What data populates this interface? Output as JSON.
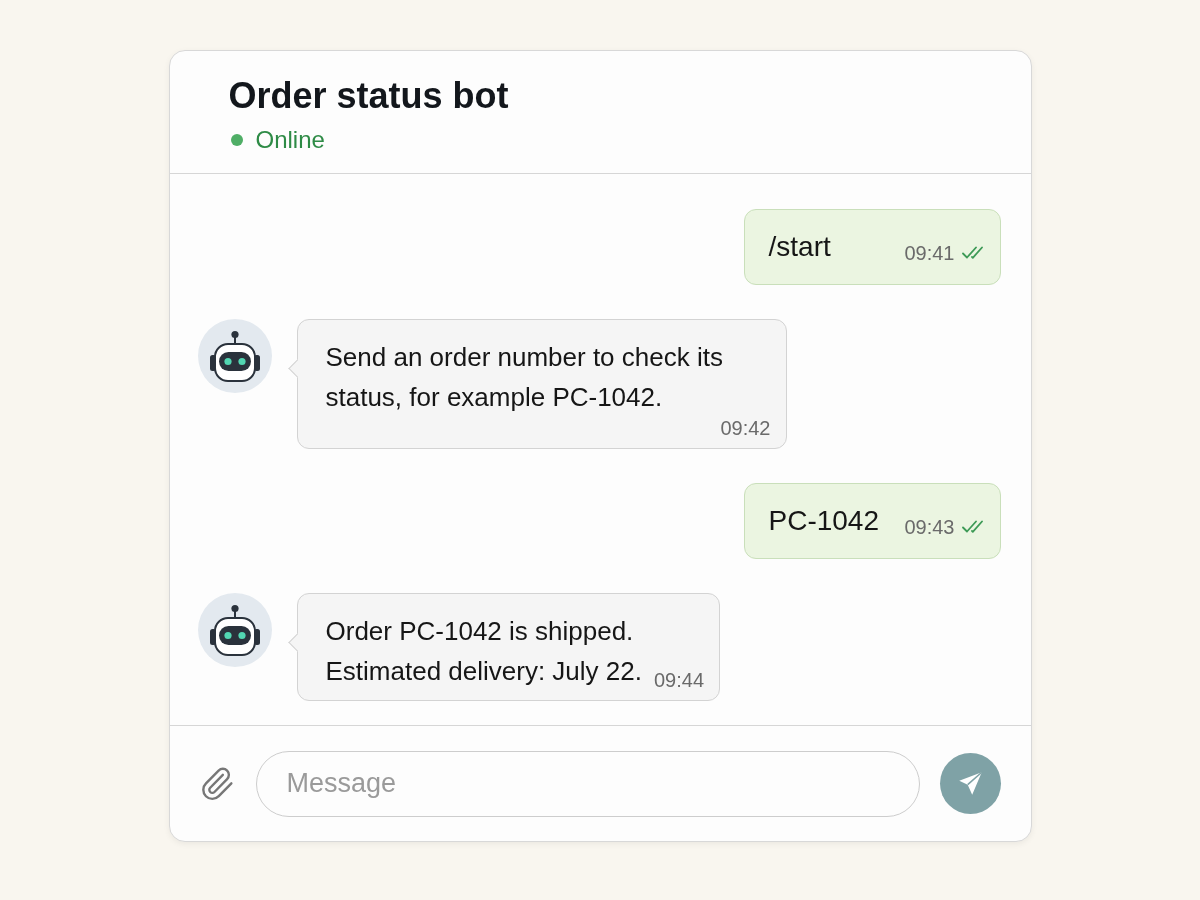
{
  "header": {
    "title": "Order status bot",
    "status": "Online",
    "online": true
  },
  "messages": [
    {
      "kind": "outgoing",
      "text": "/start",
      "time": "09:41",
      "read": true
    },
    {
      "kind": "incoming",
      "text": "Send an order number to check its status, for example PC-1042.",
      "time": "09:42"
    },
    {
      "kind": "outgoing",
      "text": "PC-1042",
      "time": "09:43",
      "read": true
    },
    {
      "kind": "incoming",
      "text": "Order PC-1042 is shipped.\nEstimated delivery: July 22.",
      "time": "09:44"
    }
  ],
  "composer": {
    "placeholder": "Message"
  }
}
